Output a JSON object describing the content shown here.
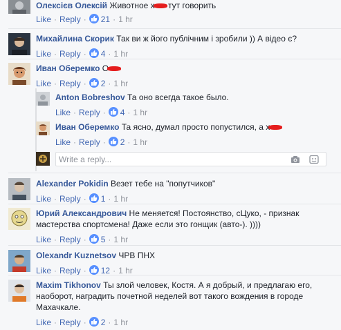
{
  "labels": {
    "like": "Like",
    "reply": "Reply"
  },
  "colors": {
    "author": "#365899",
    "link": "#4267b2",
    "meta": "#90949c",
    "censor": "#e51e1e",
    "like_badge": "#5890ff"
  },
  "comments": [
    {
      "author": "Олексієв Олексій",
      "text_before": "Животное х",
      "text_after": "тут говорить",
      "censored": true,
      "likes": "21",
      "time": "1 hr"
    },
    {
      "author": "Михайлина Скорик",
      "text": "Так ви ж його публічним і зробили )) А відео є?",
      "likes": "4",
      "time": "1 hr"
    },
    {
      "author": "Иван Оберемко",
      "text_before": "О",
      "text_after": "",
      "censored": true,
      "likes": "2",
      "time": "1 hr"
    },
    {
      "author": "Anton Bobreshov",
      "text": "Та оно всегда такое было.",
      "likes": "4",
      "time": "1 hr"
    },
    {
      "author": "Иван Оберемко",
      "text_before": "Та ясно, думал просто попустился, а х",
      "text_after": "",
      "censored": true,
      "likes": "2",
      "time": "1 hr"
    },
    {
      "author": "Alexander Pokidin",
      "text": "Везет тебе на \"попутчиков\"",
      "likes": "1",
      "time": "1 hr"
    },
    {
      "author": "Юрий Александрович",
      "text": "Не меняется! Постоянство, сЦуко, - признак мастерства спортсмена! Даже если это гонщик (авто-). ))))",
      "likes": "5",
      "time": "1 hr"
    },
    {
      "author": "Olexandr Kuznetsov",
      "text": "ЧРВ ПНХ",
      "likes": "12",
      "time": "1 hr"
    },
    {
      "author": "Maxim Tikhonov",
      "text": "Ты злой человек, Костя. А я добрый, и предлагаю его, наоборот, наградить почетной неделей вот такого вождения в городе Махачкале.",
      "likes": "2",
      "time": "1 hr"
    }
  ],
  "reply_box": {
    "placeholder": "Write a reply...",
    "icons": [
      "camera-icon",
      "sticker-icon"
    ]
  }
}
